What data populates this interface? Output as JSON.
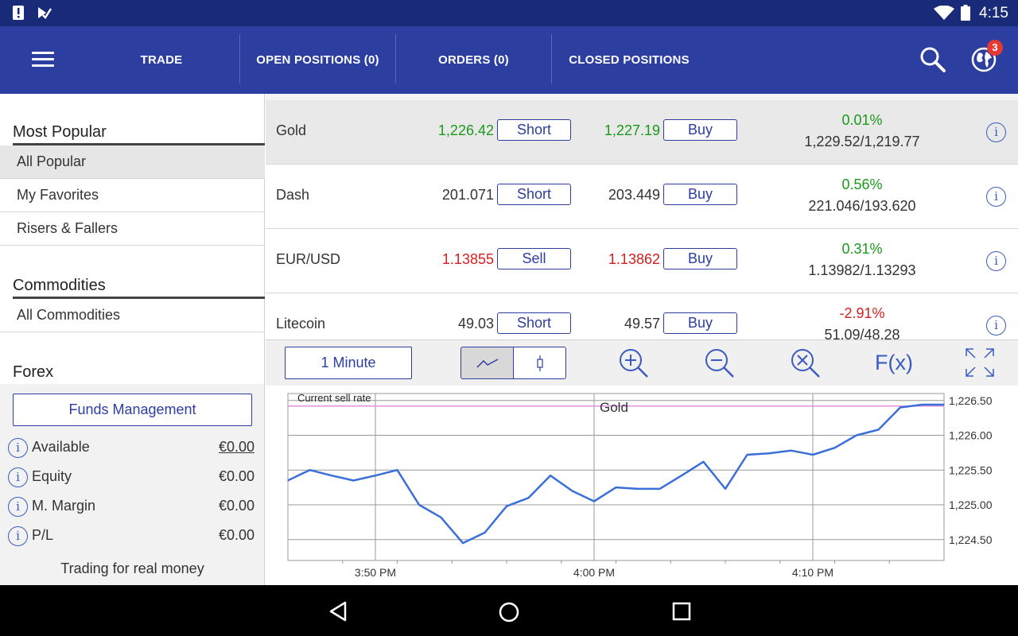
{
  "status": {
    "time": "4:15"
  },
  "header": {
    "tabs": [
      "TRADE",
      "OPEN POSITIONS (0)",
      "ORDERS (0)",
      "CLOSED POSITIONS"
    ],
    "notification_count": "3"
  },
  "sidebar": {
    "sections": [
      {
        "title": "Most Popular",
        "items": [
          "All Popular",
          "My Favorites",
          "Risers & Fallers"
        ]
      },
      {
        "title": "Commodities",
        "items": [
          "All Commodities"
        ]
      },
      {
        "title": "Forex",
        "items": []
      }
    ]
  },
  "funds": {
    "button_label": "Funds Management",
    "rows": [
      {
        "label": "Available",
        "value": "€0.00"
      },
      {
        "label": "Equity",
        "value": "€0.00"
      },
      {
        "label": "M. Margin",
        "value": "€0.00"
      },
      {
        "label": "P/L",
        "value": "€0.00"
      }
    ],
    "footer": "Trading for real money"
  },
  "instruments": [
    {
      "name": "Gold",
      "sell_price": "1,226.42",
      "sell_label": "Short",
      "buy_price": "1,227.19",
      "buy_label": "Buy",
      "change": "0.01%",
      "range": "1,229.52/1,219.77"
    },
    {
      "name": "Dash",
      "sell_price": "201.071",
      "sell_label": "Short",
      "buy_price": "203.449",
      "buy_label": "Buy",
      "change": "0.56%",
      "range": "221.046/193.620"
    },
    {
      "name": "EUR/USD",
      "sell_price": "1.13855",
      "sell_label": "Sell",
      "buy_price": "1.13862",
      "buy_label": "Buy",
      "change": "0.31%",
      "range": "1.13982/1.13293"
    },
    {
      "name": "Litecoin",
      "sell_price": "49.03",
      "sell_label": "Short",
      "buy_price": "49.57",
      "buy_label": "Buy",
      "change": "-2.91%",
      "range": "51.09/48.28"
    }
  ],
  "chart_toolbar": {
    "timeframe": "1 Minute",
    "fx_label": "F(x)"
  },
  "colors": {
    "primary": "#2c3ea0",
    "statusbar": "#192a78",
    "positive": "#1a9a1a",
    "negative": "#d42020",
    "line": "#3b6fd8",
    "sell_rate_line": "#e090e0"
  },
  "chart_data": {
    "type": "line",
    "title": "Gold",
    "annotation": "Current sell rate",
    "current_sell_rate": 1226.42,
    "x_ticks": [
      "3:50 PM",
      "4:00 PM",
      "4:10 PM"
    ],
    "y_ticks": [
      "1,226.50",
      "1,226.00",
      "1,225.50",
      "1,225.00",
      "1,224.50"
    ],
    "ylim": [
      1224.2,
      1226.6
    ],
    "grid": true,
    "x_minutes_from_350": [
      -4,
      -3,
      -2,
      -1,
      0,
      1,
      2,
      3,
      4,
      5,
      6,
      7,
      8,
      9,
      10,
      11,
      12,
      13,
      14,
      15,
      16,
      17,
      18,
      19,
      20,
      21,
      22,
      23,
      24,
      25,
      26,
      27,
      28,
      29,
      30
    ],
    "values": [
      1225.35,
      1225.5,
      1225.42,
      1225.35,
      1225.42,
      1225.5,
      1225.0,
      1224.82,
      1224.45,
      1224.6,
      1224.98,
      1225.1,
      1225.42,
      1225.2,
      1225.05,
      1225.25,
      1225.23,
      1225.23,
      1225.42,
      1225.62,
      1225.23,
      1225.72,
      1225.74,
      1225.78,
      1225.72,
      1225.82,
      1226.0,
      1226.08,
      1226.4,
      1226.44,
      1226.44
    ]
  }
}
